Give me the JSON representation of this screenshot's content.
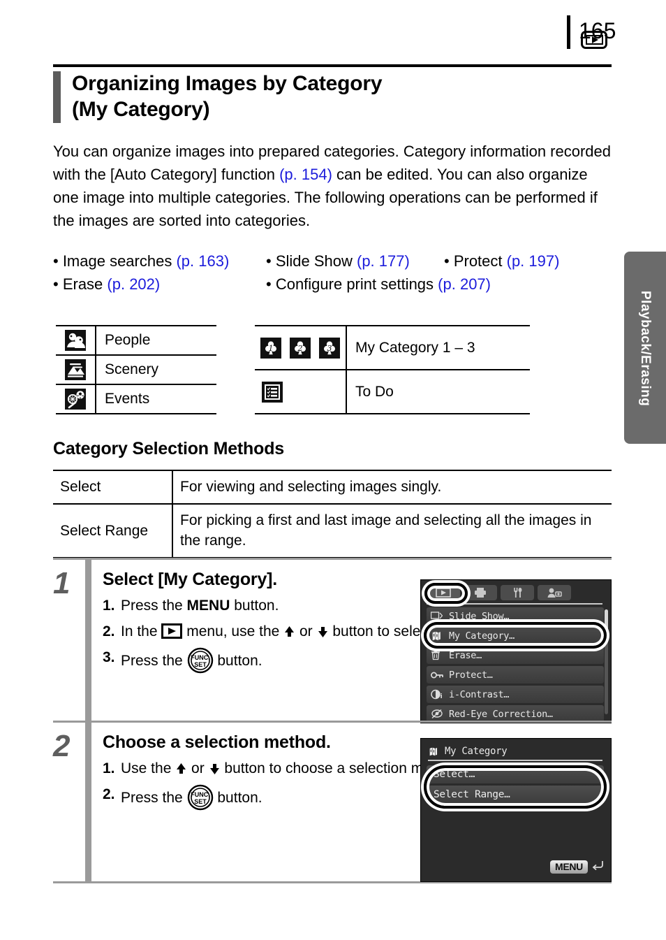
{
  "page": {
    "number": "165"
  },
  "side_tab": {
    "label": "Playback/Erasing",
    "color": "#6b6b6b"
  },
  "header": {
    "title_line1": "Organizing Images by Category",
    "title_line2": "(My Category)",
    "icon": "playback-icon"
  },
  "intro": {
    "t1": "You can organize images into prepared categories. Category information recorded with the [Auto Category] function ",
    "ref1": "(p. 154)",
    "t2": " can be edited. You can also organize one image into multiple categories. The following operations can be performed if the images are sorted into categories."
  },
  "bullets": [
    {
      "label": "• Image searches ",
      "ref": "(p. 163)"
    },
    {
      "label": "• Slide Show ",
      "ref": "(p. 177)"
    },
    {
      "label": "• Protect ",
      "ref": "(p. 197)"
    },
    {
      "label": "• Erase ",
      "ref": "(p. 202)"
    },
    {
      "label": "• Configure print settings ",
      "ref": "(p. 207)"
    }
  ],
  "legend_left": [
    {
      "icon": "people-icon",
      "label": "People"
    },
    {
      "icon": "scenery-icon",
      "label": "Scenery"
    },
    {
      "icon": "events-icon",
      "label": "Events"
    }
  ],
  "legend_right": [
    {
      "icon": "my-category-1-2-3-icon",
      "label": "My Category 1 – 3"
    },
    {
      "icon": "to-do-icon",
      "label": "To Do"
    }
  ],
  "methods": {
    "heading": "Category Selection Methods",
    "rows": [
      {
        "key": "Select",
        "desc": "For viewing and selecting images singly."
      },
      {
        "key": "Select Range",
        "desc": "For picking a first and last image and selecting all the images in the range."
      }
    ]
  },
  "steps": [
    {
      "number": "1",
      "title": "Select [My Category].",
      "subs": [
        {
          "n": "1.",
          "pre": "Press the ",
          "strong": "MENU",
          "post": " button."
        },
        {
          "n": "2.",
          "pre": "In the ",
          "mid": " menu, use the ",
          "mid2": " or ",
          "mid3": " button to select ",
          "post": "."
        },
        {
          "n": "3.",
          "pre": "Press the ",
          "post": " button."
        }
      ]
    },
    {
      "number": "2",
      "title": "Choose a selection method.",
      "subs": [
        {
          "n": "1.",
          "pre": "Use the ",
          "mid2": " or ",
          "mid3": " button to choose a selection method."
        },
        {
          "n": "2.",
          "pre": "Press the ",
          "post": " button."
        }
      ]
    }
  ],
  "screen1": {
    "tabs": [
      "playback-tab",
      "print-tab",
      "settings-tab",
      "my-menu-tab"
    ],
    "rows": [
      {
        "icon": "slide-show-icon",
        "label": "Slide Show…"
      },
      {
        "icon": "my-category-icon",
        "label": "My Category…"
      },
      {
        "icon": "erase-icon",
        "label": "Erase…"
      },
      {
        "icon": "protect-icon",
        "label": "Protect…"
      },
      {
        "icon": "i-contrast-icon",
        "label": "i-Contrast…"
      },
      {
        "icon": "red-eye-correction-icon",
        "label": "Red-Eye Correction…"
      }
    ]
  },
  "screen2": {
    "title": "My Category",
    "rows": [
      "Select…",
      "Select Range…"
    ],
    "badge": "MENU"
  }
}
